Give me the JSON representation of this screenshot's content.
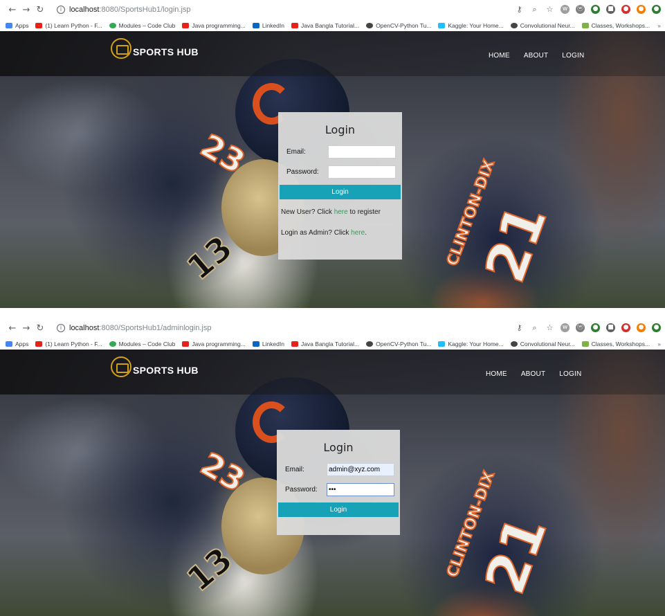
{
  "browser": {
    "url_host": "localhost",
    "url_rest_1": ":8080/SportsHub1/login.jsp",
    "url_rest_2": ":8080/SportsHub1/adminlogin.jsp",
    "bookmarks": [
      {
        "label": "Apps",
        "color": "#4285f4"
      },
      {
        "label": "(1) Learn Python - F...",
        "color": "#e62117"
      },
      {
        "label": "Modules – Code Club",
        "color": "#34a853"
      },
      {
        "label": "Java programming...",
        "color": "#e62117"
      },
      {
        "label": "LinkedIn",
        "color": "#0a66c2"
      },
      {
        "label": "Java Bangla Tutorial...",
        "color": "#e62117"
      },
      {
        "label": "OpenCV-Python Tu...",
        "color": "#444444"
      },
      {
        "label": "Kaggle: Your Home...",
        "color": "#20beff"
      },
      {
        "label": "Convolutional Neur...",
        "color": "#444444"
      },
      {
        "label": "Classes, Workshops...",
        "color": "#7cb342"
      }
    ],
    "more": "»"
  },
  "site": {
    "brand": "SPORTS HUB",
    "nav": [
      "HOME",
      "ABOUT",
      "LOGIN"
    ]
  },
  "login_page": {
    "title": "Login",
    "email_label": "Email:",
    "password_label": "Password:",
    "email_value": "",
    "password_value": "",
    "button": "Login",
    "new_user_prefix": "New User? Click ",
    "new_user_link": "here",
    "new_user_suffix": " to register",
    "admin_prefix": "Login as Admin? Click ",
    "admin_link": "here",
    "admin_suffix": "."
  },
  "admin_page": {
    "title": "Login",
    "email_label": "Email:",
    "password_label": "Password:",
    "email_value": "admin@xyz.com",
    "password_value": "•••",
    "button": "Login"
  },
  "accent_color": "#17a2b8"
}
